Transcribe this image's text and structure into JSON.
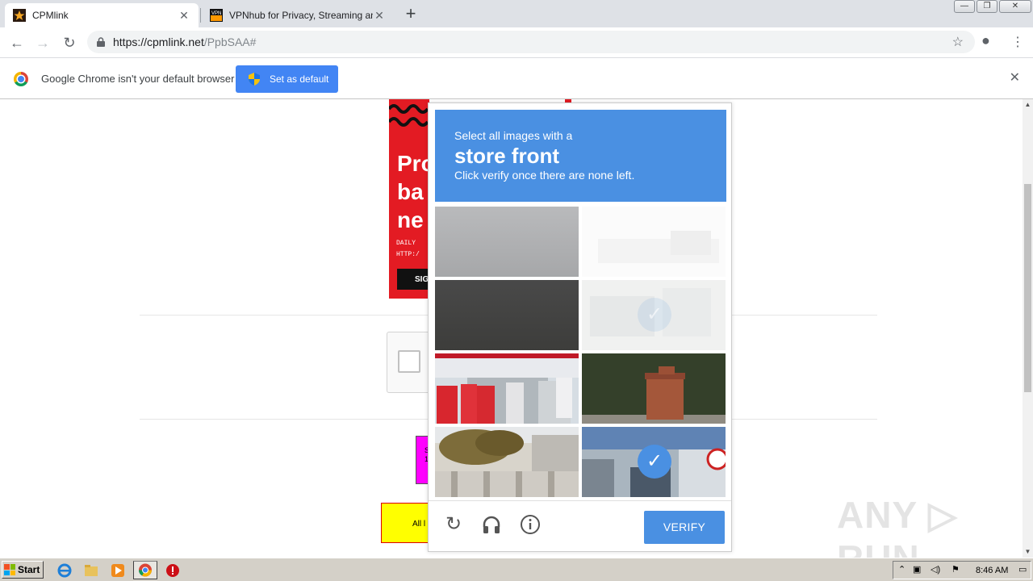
{
  "browser": {
    "tabs": [
      {
        "title": "CPMlink",
        "favicon": "star-favicon",
        "active": true
      },
      {
        "title": "VPNhub for Privacy, Streaming and P",
        "favicon": "vpnhub-favicon",
        "active": false
      }
    ],
    "tab_close": "✕",
    "new_tab": "+",
    "window_controls": {
      "minimize": "—",
      "restore": "❐",
      "close": "✕"
    },
    "nav": {
      "back": "←",
      "forward": "→",
      "reload": "↻"
    },
    "url": {
      "host": "https://cpmlink.net",
      "path": "/PpbSAA#"
    },
    "bookmark_star": "☆",
    "profile": "●",
    "menu": "⋮"
  },
  "infobar": {
    "message": "Google Chrome isn't your default browser",
    "button_label": "Set as default",
    "close": "✕"
  },
  "page": {
    "ad_text": "Pro\nba\nne",
    "ad_small": "DAILY\nHTTP:/",
    "ad_button": "SIG",
    "magenta_text": "S\n1(",
    "yellow_text": "All l",
    "watermark": "ANY ▷ RUN"
  },
  "captcha": {
    "instruction_line1": "Select all images with a",
    "instruction_target": "store front",
    "instruction_line3": "Click verify once there are none left.",
    "tiles": [
      {
        "desc": "gray-wall",
        "selected": false
      },
      {
        "desc": "faded-tile",
        "selected": false
      },
      {
        "desc": "dark-road",
        "selected": false
      },
      {
        "desc": "faded-selected-tile",
        "selected": true
      },
      {
        "desc": "shop-banners",
        "selected": false
      },
      {
        "desc": "brick-pillar-hedge",
        "selected": false
      },
      {
        "desc": "tree-building",
        "selected": false
      },
      {
        "desc": "storefront-sign",
        "selected": true
      }
    ],
    "check_mark": "✓",
    "verify_label": "VERIFY",
    "reload_icon": "↻",
    "audio_icon": "🎧",
    "info_icon": "ⓘ"
  },
  "taskbar": {
    "start_label": "Start",
    "clock": "8:46 AM"
  }
}
